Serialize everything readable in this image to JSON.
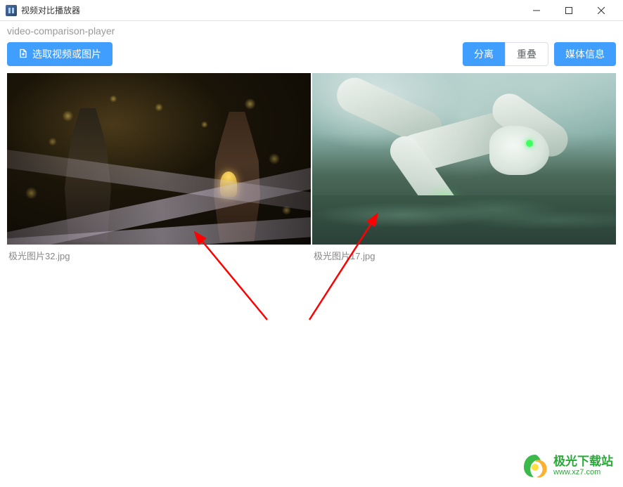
{
  "window": {
    "title": "视频对比播放器",
    "subtitle": "video-comparison-player"
  },
  "toolbar": {
    "select_label": "选取视频或图片",
    "separate_label": "分离",
    "overlap_label": "重叠",
    "media_info_label": "媒体信息"
  },
  "media": [
    {
      "filename": "极光图片32.jpg"
    },
    {
      "filename": "极光图片17.jpg"
    }
  ],
  "watermark": {
    "title": "极光下载站",
    "url": "www.xz7.com"
  }
}
